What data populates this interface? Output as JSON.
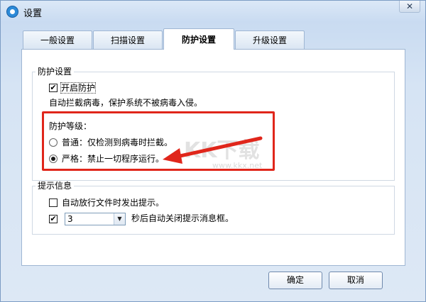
{
  "window": {
    "title": "设置",
    "close_symbol": "✕"
  },
  "tabs": [
    {
      "label": "一般设置",
      "active": false
    },
    {
      "label": "扫描设置",
      "active": false
    },
    {
      "label": "防护设置",
      "active": true
    },
    {
      "label": "升级设置",
      "active": false
    }
  ],
  "protection": {
    "group_title": "防护设置",
    "enable_label": "开启防护",
    "enable_checked": true,
    "description": "自动拦截病毒，保护系统不被病毒入侵。",
    "level_title": "防护等级：",
    "levels": [
      {
        "label": "普通：仅检测到病毒时拦截。",
        "selected": false
      },
      {
        "label": "严格：禁止一切程序运行。",
        "selected": true
      }
    ]
  },
  "notify": {
    "group_title": "提示信息",
    "release_label": "自动放行文件时发出提示。",
    "release_checked": false,
    "autoclose_checked": true,
    "seconds_value": "3",
    "autoclose_label": "秒后自动关闭提示消息框。"
  },
  "buttons": {
    "ok": "确定",
    "cancel": "取消"
  },
  "overlay": {
    "watermark": "KK下载",
    "watermark_url": "www.kkx.net",
    "annotation_color": "#e0261b"
  },
  "icons": {
    "app": "app-logo-icon",
    "close": "close-icon",
    "check": "✔",
    "dropdown": "▼"
  }
}
